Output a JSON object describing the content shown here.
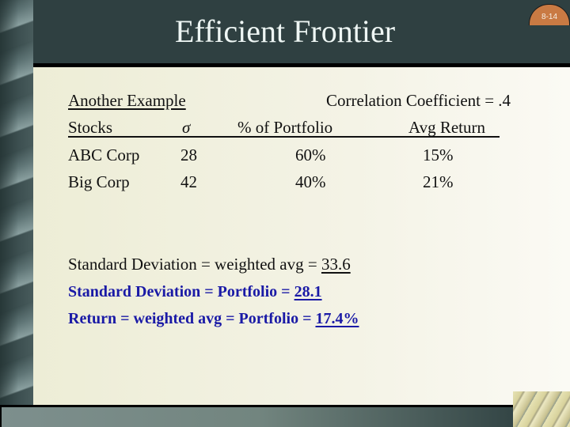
{
  "slide": {
    "title": "Efficient Frontier",
    "page_number": "8-14"
  },
  "example": {
    "label": "Another Example",
    "correlation": "Correlation Coefficient = .4",
    "columns": [
      "Stocks",
      "σ",
      "% of Portfolio",
      "Avg Return"
    ],
    "rows": [
      {
        "stock": "ABC Corp",
        "sigma": "28",
        "weight": "60%",
        "return": "15%"
      },
      {
        "stock": "Big Corp",
        "sigma": "42",
        "weight": "40%",
        "return": "21%"
      }
    ]
  },
  "results": {
    "line1_text": "Standard Deviation = weighted avg = ",
    "line1_value": "33.6 ",
    "line2_text": "Standard Deviation = Portfolio  =  ",
    "line2_value": "28.1",
    "line3_text": "Return = weighted avg = Portfolio = ",
    "line3_value": "17.4%"
  },
  "colors": {
    "header_bg": "#2f4041",
    "content_bg": "#f1f0df",
    "highlight_text": "#1a1aa6",
    "page_badge": "#c97a43"
  }
}
